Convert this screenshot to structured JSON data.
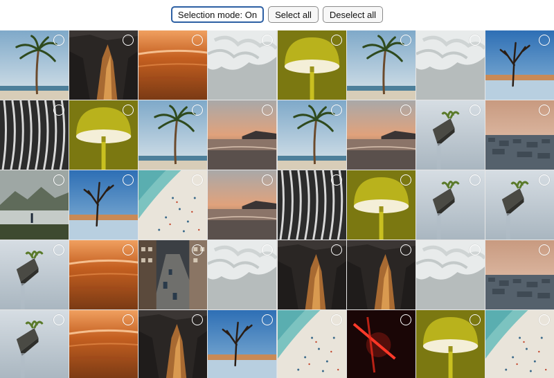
{
  "toolbar": {
    "selection_mode_label": "Selection mode: On",
    "select_all_label": "Select all",
    "deselect_all_label": "Deselect all"
  },
  "photos": [
    [
      "palm-beach",
      "canyon-cliff",
      "orange-abstract",
      "white-sculpture",
      "olive-lamp",
      "palm-beach",
      "white-sculpture",
      "dead-tree-desert"
    ],
    [
      "zebra-stripes",
      "olive-lamp",
      "palm-beach",
      "sunset-coast",
      "palm-beach",
      "sunset-coast",
      "rock-islet",
      "city-dusk"
    ],
    [
      "mountain-lake",
      "dead-tree-desert",
      "aerial-beach",
      "sunset-coast",
      "zebra-stripes",
      "olive-lamp",
      "rock-islet",
      "rock-islet"
    ],
    [
      "rock-islet",
      "orange-abstract",
      "city-street",
      "white-sculpture",
      "canyon-cliff",
      "canyon-cliff",
      "white-sculpture",
      "city-dusk"
    ],
    [
      "rock-islet",
      "orange-abstract",
      "canyon-cliff",
      "dead-tree-desert",
      "aerial-beach",
      "red-neon",
      "olive-lamp",
      "aerial-beach"
    ]
  ]
}
